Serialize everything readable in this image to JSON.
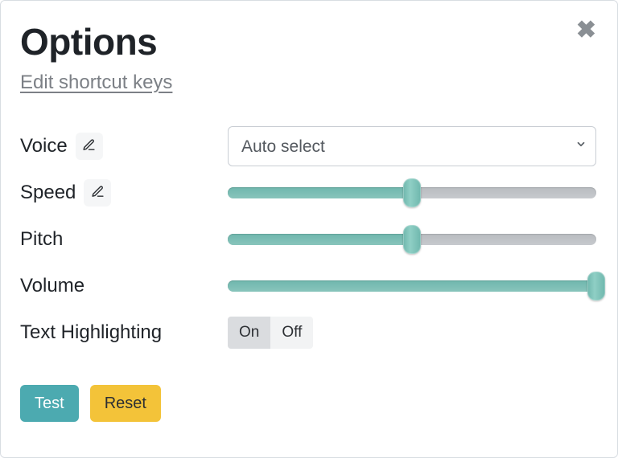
{
  "title": "Options",
  "shortcut_link": "Edit shortcut keys",
  "voice": {
    "label": "Voice",
    "selected": "Auto select",
    "options": [
      "Auto select"
    ]
  },
  "speed": {
    "label": "Speed",
    "value": 50,
    "min": 0,
    "max": 100
  },
  "pitch": {
    "label": "Pitch",
    "value": 50,
    "min": 0,
    "max": 100
  },
  "volume": {
    "label": "Volume",
    "value": 100,
    "min": 0,
    "max": 100
  },
  "highlighting": {
    "label": "Text Highlighting",
    "on_label": "On",
    "off_label": "Off",
    "value": "On"
  },
  "buttons": {
    "test": "Test",
    "reset": "Reset"
  },
  "colors": {
    "accent_teal": "#4caab0",
    "accent_yellow": "#f3c339",
    "slider_fill": "#7ec0b7",
    "slider_track": "#c1c5c9"
  }
}
